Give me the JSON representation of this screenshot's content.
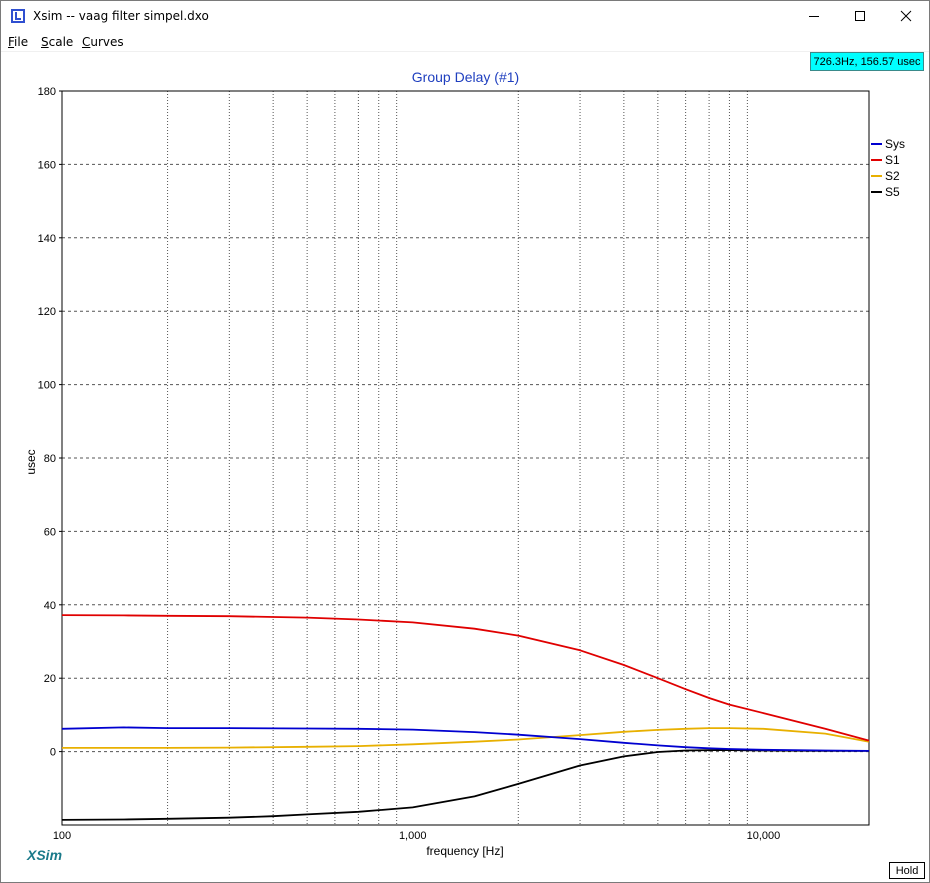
{
  "window": {
    "title": "Xsim -- vaag filter simpel.dxo",
    "controls": {
      "minimize": "minimize",
      "maximize": "maximize",
      "close": "close"
    }
  },
  "menu": [
    {
      "underline": "F",
      "rest": "ile"
    },
    {
      "underline": "S",
      "rest": "cale"
    },
    {
      "underline": "C",
      "rest": "urves"
    }
  ],
  "readout": "726.3Hz, 156.57 usec",
  "hold_label": "Hold",
  "brand": "XSim",
  "colors": {
    "Sys": "#0000d0",
    "S1": "#e00000",
    "S2": "#e8b000",
    "S5": "#000000",
    "title": "#1f3fbf",
    "readout_bg": "#00ffff",
    "brand": "#1a7a8a"
  },
  "chart_data": {
    "type": "line",
    "title": "Group Delay (#1)",
    "xlabel": "frequency [Hz]",
    "ylabel": "usec",
    "x_scale": "log",
    "xlim": [
      100,
      20000
    ],
    "ylim": [
      -20,
      180
    ],
    "y_ticks": [
      0,
      20,
      40,
      60,
      80,
      100,
      120,
      140,
      160,
      180
    ],
    "x_tick_labels": [
      {
        "value": 100,
        "label": "100"
      },
      {
        "value": 1000,
        "label": "1,000"
      },
      {
        "value": 10000,
        "label": "10,000"
      }
    ],
    "grid": true,
    "legend_position": "right",
    "series": [
      {
        "name": "Sys",
        "x": [
          100,
          150,
          200,
          300,
          500,
          700,
          1000,
          1500,
          2000,
          3000,
          4000,
          5000,
          6000,
          7000,
          8000,
          10000,
          15000,
          20000
        ],
        "y": [
          6.2,
          6.6,
          6.4,
          6.4,
          6.3,
          6.2,
          6.0,
          5.3,
          4.6,
          3.4,
          2.4,
          1.7,
          1.2,
          0.9,
          0.7,
          0.5,
          0.3,
          0.2
        ]
      },
      {
        "name": "S1",
        "x": [
          100,
          150,
          200,
          300,
          500,
          700,
          1000,
          1500,
          2000,
          3000,
          4000,
          5000,
          6000,
          7000,
          8000,
          10000,
          15000,
          20000
        ],
        "y": [
          37.2,
          37.1,
          37.0,
          36.9,
          36.5,
          36.0,
          35.2,
          33.5,
          31.6,
          27.6,
          23.6,
          20.0,
          17.0,
          14.6,
          12.8,
          10.5,
          6.2,
          3.0
        ]
      },
      {
        "name": "S2",
        "x": [
          100,
          150,
          200,
          300,
          500,
          700,
          1000,
          1500,
          2000,
          3000,
          4000,
          5000,
          6000,
          7000,
          8000,
          10000,
          15000,
          20000
        ],
        "y": [
          1.0,
          1.0,
          1.0,
          1.1,
          1.3,
          1.5,
          2.0,
          2.7,
          3.3,
          4.5,
          5.4,
          5.9,
          6.2,
          6.4,
          6.4,
          6.2,
          4.9,
          2.7
        ]
      },
      {
        "name": "S5",
        "x": [
          100,
          150,
          200,
          300,
          400,
          500,
          700,
          1000,
          1500,
          2000,
          3000,
          4000,
          5000,
          6000,
          7000,
          8000,
          10000,
          15000,
          20000
        ],
        "y": [
          -18.6,
          -18.5,
          -18.3,
          -18.0,
          -17.6,
          -17.1,
          -16.4,
          -15.2,
          -12.2,
          -8.8,
          -3.8,
          -1.3,
          -0.1,
          0.3,
          0.4,
          0.4,
          0.3,
          0.2,
          0.2
        ]
      }
    ]
  }
}
